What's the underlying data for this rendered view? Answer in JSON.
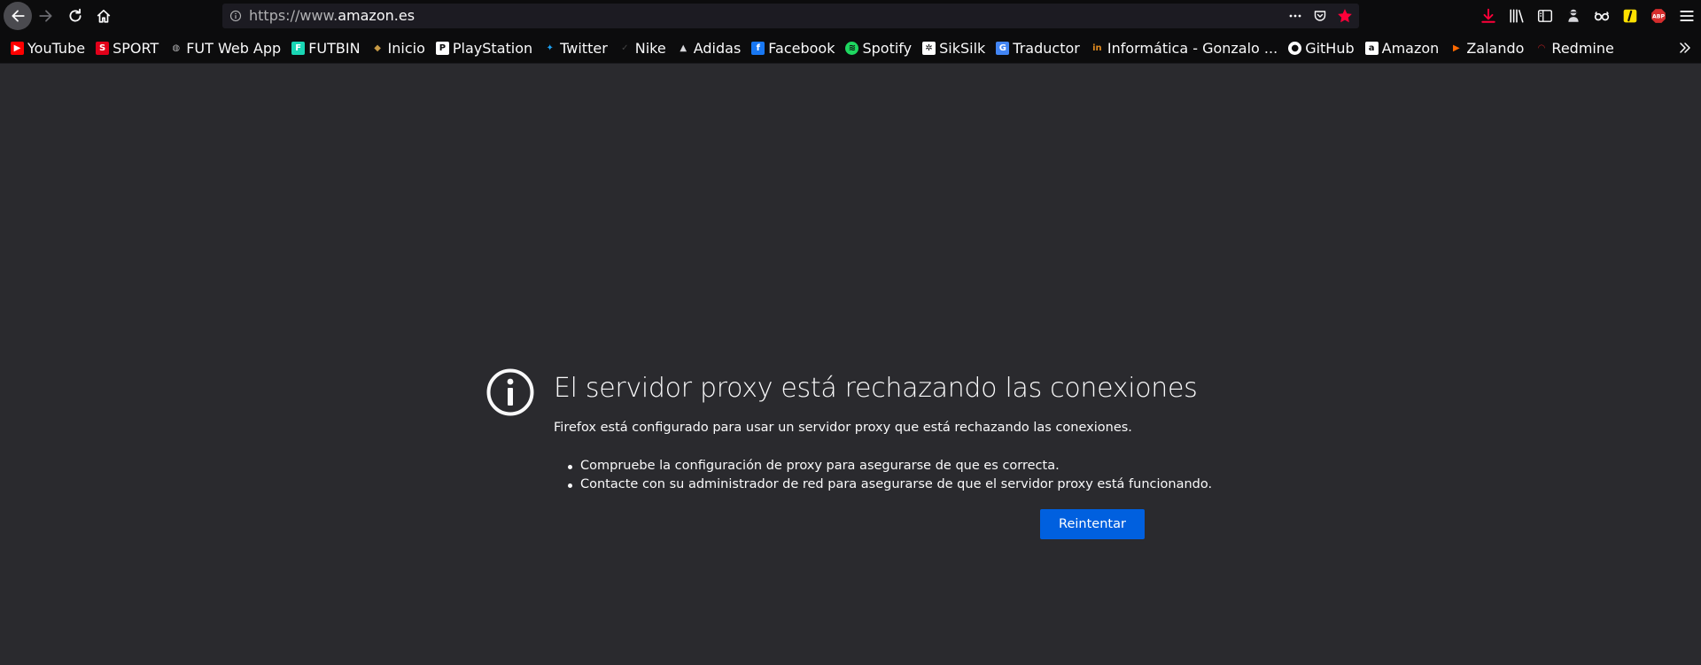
{
  "browser": {
    "url": {
      "prefix": "https://www.",
      "domain": "amazon.es"
    },
    "colors": {
      "toolbar": "#0c0c0d",
      "page_bg": "#2a2a2e",
      "accent_button": "#0060df",
      "star_bookmarked": "#ff0039",
      "download": "#ff0039"
    }
  },
  "bookmarks": [
    {
      "label": "YouTube",
      "icon": "youtube-icon",
      "color": "#ff0000"
    },
    {
      "label": "SPORT",
      "icon": "sport-icon",
      "color": "#e2001a"
    },
    {
      "label": "FUT Web App",
      "icon": "globe-icon",
      "color": "#b1b1b3"
    },
    {
      "label": "FUTBIN",
      "icon": "futbin-icon",
      "color": "#19d6b4"
    },
    {
      "label": "Inicio",
      "icon": "inicio-icon",
      "color": "#c79a45"
    },
    {
      "label": "PlayStation",
      "icon": "playstation-icon",
      "color": "#ffffff"
    },
    {
      "label": "Twitter",
      "icon": "twitter-icon",
      "color": "#1da1f2"
    },
    {
      "label": "Nike",
      "icon": "nike-icon",
      "color": "#444444"
    },
    {
      "label": "Adidas",
      "icon": "adidas-icon",
      "color": "#000000"
    },
    {
      "label": "Facebook",
      "icon": "facebook-icon",
      "color": "#1877f2"
    },
    {
      "label": "Spotify",
      "icon": "spotify-icon",
      "color": "#1ed760"
    },
    {
      "label": "SikSilk",
      "icon": "siksilk-icon",
      "color": "#ffffff"
    },
    {
      "label": "Traductor",
      "icon": "translate-icon",
      "color": "#4285f4"
    },
    {
      "label": "Informática - Gonzalo ...",
      "icon": "informatica-icon",
      "color": "#e08a1e"
    },
    {
      "label": "GitHub",
      "icon": "github-icon",
      "color": "#ffffff"
    },
    {
      "label": "Amazon",
      "icon": "amazon-icon",
      "color": "#ffffff"
    },
    {
      "label": "Zalando",
      "icon": "zalando-icon",
      "color": "#ff6900"
    },
    {
      "label": "Redmine",
      "icon": "redmine-icon",
      "color": "#b32024"
    }
  ],
  "error": {
    "title": "El servidor proxy está rechazando las conexiones",
    "description": "Firefox está configurado para usar un servidor proxy que está rechazando las conexiones.",
    "items": [
      "Compruebe la configuración de proxy para asegurarse de que es correcta.",
      "Contacte con su administrador de red para asegurarse de que el servidor proxy está funcionando."
    ],
    "retry_label": "Reintentar"
  },
  "toolbar_icons": {
    "extension_a_label": "ABP"
  }
}
